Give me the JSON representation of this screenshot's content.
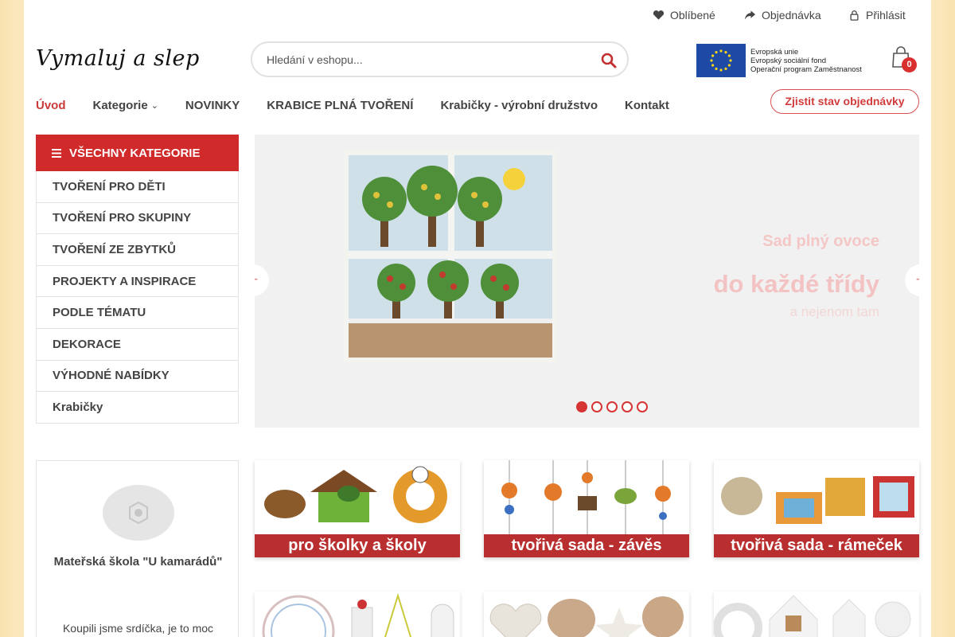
{
  "topbar": {
    "favorites": "Oblíbené",
    "orders": "Objednávka",
    "login": "Přihlásit"
  },
  "header": {
    "logo": "Vymaluj a slep",
    "search_placeholder": "Hledání v eshopu...",
    "eu_lines": [
      "Evropská unie",
      "Evropský sociální fond",
      "Operační program Zaměstnanost"
    ],
    "cart_count": "0"
  },
  "nav": {
    "items": [
      "Úvod",
      "Kategorie",
      "NOVINKY",
      "KRABICE PLNÁ TVOŘENÍ",
      "Krabičky - výrobní družstvo",
      "Kontakt"
    ],
    "order_status": "Zjistit stav objednávky"
  },
  "sidebar": {
    "title": "VŠECHNY KATEGORIE",
    "items": [
      "TVOŘENÍ PRO DĚTI",
      "TVOŘENÍ PRO SKUPINY",
      "TVOŘENÍ ZE ZBYTKŮ",
      "PROJEKTY A INSPIRACE",
      "PODLE TÉMATU",
      "DEKORACE",
      "VÝHODNÉ NABÍDKY",
      "Krabičky"
    ]
  },
  "slider": {
    "line1": "Sad plný ovoce",
    "line2": "do každé třídy",
    "line3": "a nejenom tam",
    "dots": 5,
    "active_dot": 1
  },
  "review": {
    "name": "Mateřská škola \"U kamarádů\"",
    "text": "Koupili jsme srdíčka, je to moc"
  },
  "banners": [
    "pro školky a školy",
    "tvořivá sada - závěs",
    "tvořivá sada - rámeček"
  ],
  "colors": {
    "accent": "#d12a2a",
    "caption_bg": "#b92f2f",
    "side_bg": "#f9e3b0"
  }
}
